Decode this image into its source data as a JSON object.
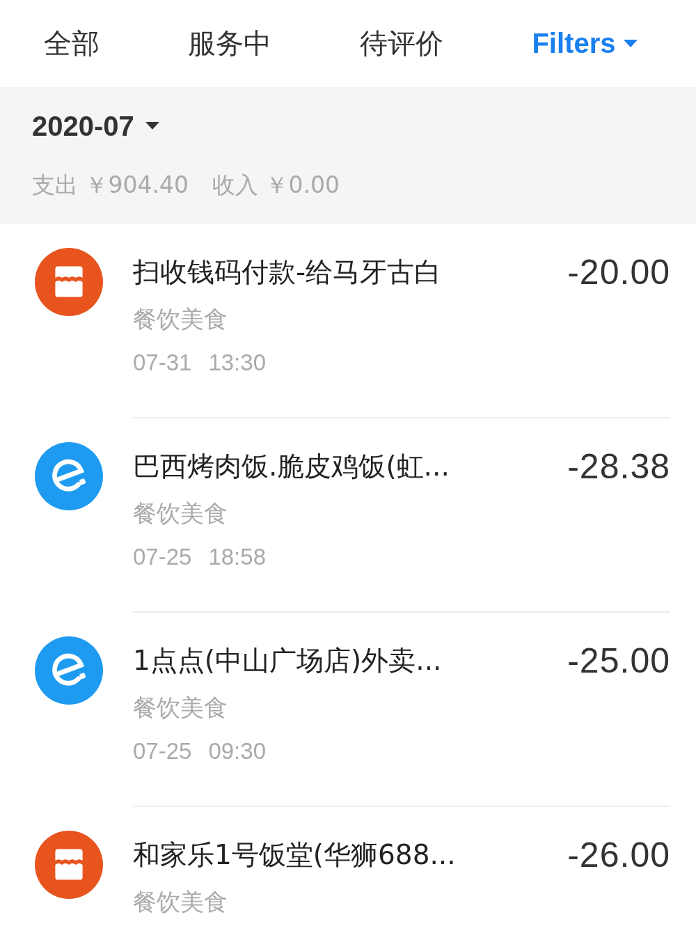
{
  "tabs": [
    {
      "label": "全部",
      "selected": false
    },
    {
      "label": "服务中",
      "selected": false
    },
    {
      "label": "待评价",
      "selected": false
    }
  ],
  "filters": {
    "label": "Filters"
  },
  "month": {
    "label": "2020-07",
    "summary": [
      "支出 ￥904.40",
      "收入 ￥0.00"
    ]
  },
  "transactions": [
    {
      "kind": "store",
      "title": "扫收钱码付款-给马牙古白",
      "category": "餐饮美食",
      "date": "07-31",
      "time": "13:30",
      "amount": "-20.00"
    },
    {
      "kind": "delivery",
      "title": "巴西烤肉饭.脆皮鸡饭(虹...",
      "category": "餐饮美食",
      "date": "07-25",
      "time": "18:58",
      "amount": "-28.38"
    },
    {
      "kind": "delivery",
      "title": "1点点(中山广场店)外卖...",
      "category": "餐饮美食",
      "date": "07-25",
      "time": "09:30",
      "amount": "-25.00"
    },
    {
      "kind": "store",
      "title": "和家乐1号饭堂(华狮688...",
      "category": "餐饮美食",
      "amount": "-26.00"
    }
  ]
}
